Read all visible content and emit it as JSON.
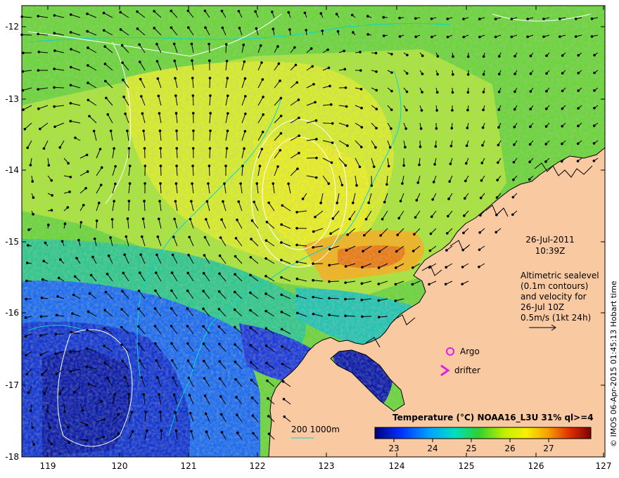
{
  "map": {
    "date": "26-Jul-2011",
    "time": "10:39Z",
    "altimetry_note": [
      "Altimetric sealevel",
      "(0.1m contours)",
      "and velocity for",
      "26-Jul 10Z",
      "0.5m/s (1kt 24h)"
    ],
    "argo_label": "Argo",
    "drifter_label": "drifter",
    "isobath_label": "200  1000m",
    "credit": "© IMOS 06-Apr-2015 01:45:13 Hobart time",
    "colorbar": {
      "title": "Temperature (°C) NOAA16_L3U 31% ql>=4",
      "ticks": [
        "23",
        "24",
        "25",
        "26",
        "27"
      ]
    },
    "lon_ticks": [
      "119",
      "120",
      "121",
      "122",
      "123",
      "124",
      "125",
      "126",
      "127"
    ],
    "lat_ticks": [
      "-12",
      "-13",
      "-14",
      "-15",
      "-16",
      "-17",
      "-18"
    ],
    "colors": {
      "land": "#f9c9a1",
      "frame": "#000000",
      "contour": "#ffffff",
      "isobath": "#00d8d8",
      "argo": "#e020e0",
      "drifter": "#e020e0"
    }
  }
}
